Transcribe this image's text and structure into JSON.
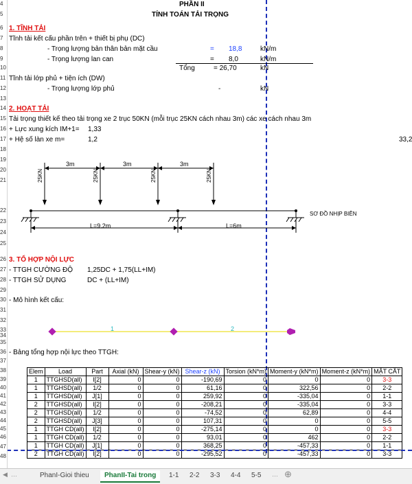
{
  "row_numbers": [
    "4",
    "5",
    "6",
    "7",
    "8",
    "9",
    "10",
    "11",
    "12",
    "13",
    "14",
    "15",
    "16",
    "17",
    "18",
    "19",
    "20",
    "21",
    "22",
    "23",
    "24",
    "25",
    "26",
    "27",
    "28",
    "29",
    "30",
    "31",
    "32",
    "33",
    "34",
    "35",
    "36",
    "37",
    "38",
    "39",
    "40",
    "41",
    "42",
    "43",
    "44",
    "45",
    "46",
    "47",
    "48"
  ],
  "header": {
    "part": "PHẦN II",
    "title": "TÍNH TOÁN TẢI TRỌNG"
  },
  "sec1": {
    "heading": "1. TĨNH TẢI",
    "dc_title": "Tĩnh tải kết cấu phần trên + thiết bị phụ (DC)",
    "slab_label": "- Trọng lượng bản thân bản mặt cầu",
    "slab_eq": "=",
    "slab_val": "18,8",
    "rail_label": "- Trọng lượng lan can",
    "rail_eq": "=",
    "rail_val": "8,0",
    "unit_knm": "kN/m",
    "unit_kn": "kN",
    "total_label": "Tổng",
    "total_val": "= 26,70",
    "dw_title": "Tĩnh tải lớp phủ + tiện ích (DW)",
    "layer_label": "- Trọng lượng lớp phủ",
    "layer_val": "-",
    "layer_unit": "kN"
  },
  "sec2": {
    "heading": "2. HOẠT TẢI",
    "desc": "Tải trọng thiết kế theo tải trọng xe 2 trục 50KN (mỗi trục 25KN cách nhau 3m) các xe cách nhau 3m",
    "im_label": "+ Lực xung kích IM+1=",
    "im_val": "1,33",
    "m_label": "+ Hệ số làn xe m=",
    "m_val": "1,2",
    "edge_val": "33,2"
  },
  "diagram": {
    "spacing_labels": [
      "3m",
      "3m",
      "3m"
    ],
    "load_labels": [
      "25KN",
      "25KN",
      "25KN",
      "25KN"
    ],
    "span1": "L=9.2m",
    "span2": "L=6m",
    "caption": "SƠ ĐỒ NHỊP BIÊN"
  },
  "sec3": {
    "heading": "3. TỔ HỢP NỘI LỰC",
    "uls_label": "- TTGH CƯỜNG ĐỘ",
    "uls_formula": "1,25DC  + 1,75(LL+IM)",
    "sls_label": "- TTGH SỬ DỤNG",
    "sls_formula": "DC  +  (LL+IM)",
    "model_label": "- Mô hình kết cấu:",
    "model_elems": [
      "1",
      "2"
    ],
    "table_label": "- Bảng tổng hợp nội lực theo TTGH:"
  },
  "table": {
    "headers": [
      "Elem",
      "Load",
      "Part",
      "Axial (kN)",
      "Shear-y (kN)",
      "Shear-z (kN)",
      "Torsion (kN*m)",
      "Moment-y (kN*m)",
      "Moment-z (kN*m)",
      "MẶT CẮT"
    ],
    "rows": [
      [
        "1",
        "TTGHSD(all)",
        "I[2]",
        "0",
        "0",
        "-190,69",
        "0",
        "0",
        "0",
        "3-3"
      ],
      [
        "1",
        "TTGHSD(all)",
        "1/2",
        "0",
        "0",
        "61,16",
        "0",
        "322,56",
        "0",
        "2-2"
      ],
      [
        "1",
        "TTGHSD(all)",
        "J[1]",
        "0",
        "0",
        "259,92",
        "0",
        "-335,04",
        "0",
        "1-1"
      ],
      [
        "2",
        "TTGHSD(all)",
        "I[2]",
        "0",
        "0",
        "-208,21",
        "0",
        "-335,04",
        "0",
        "3-3"
      ],
      [
        "2",
        "TTGHSD(all)",
        "1/2",
        "0",
        "0",
        "-74,52",
        "0",
        "62,89",
        "0",
        "4-4"
      ],
      [
        "2",
        "TTGHSD(all)",
        "J[3]",
        "0",
        "0",
        "107,31",
        "0",
        "0",
        "0",
        "5-5"
      ],
      [
        "1",
        "TTGH CD(all)",
        "I[2]",
        "0",
        "0",
        "-275,14",
        "0",
        "0",
        "0",
        "3-3"
      ],
      [
        "1",
        "TTGH CD(all)",
        "1/2",
        "0",
        "0",
        "93,01",
        "0",
        "462",
        "0",
        "2-2"
      ],
      [
        "1",
        "TTGH CD(all)",
        "J[1]",
        "0",
        "0",
        "368,25",
        "0",
        "-457,33",
        "0",
        "1-1"
      ],
      [
        "2",
        "TTGH CD(all)",
        "I[2]",
        "0",
        "0",
        "-295,52",
        "0",
        "-457,33",
        "0",
        "3-3"
      ]
    ],
    "red_cut_rows": [
      0,
      6
    ]
  },
  "tabs": [
    "PhanI-Gioi thieu",
    "PhanII-Tai trong",
    "1-1",
    "2-2",
    "3-3",
    "4-4",
    "5-5"
  ],
  "active_tab": 1,
  "colors": {
    "accent_red": "#e01010",
    "value_blue": "#1a3fff",
    "page_break": "#1c2fb8",
    "tab_active": "#1a7a3a",
    "shear_header": "#1a3fff"
  }
}
